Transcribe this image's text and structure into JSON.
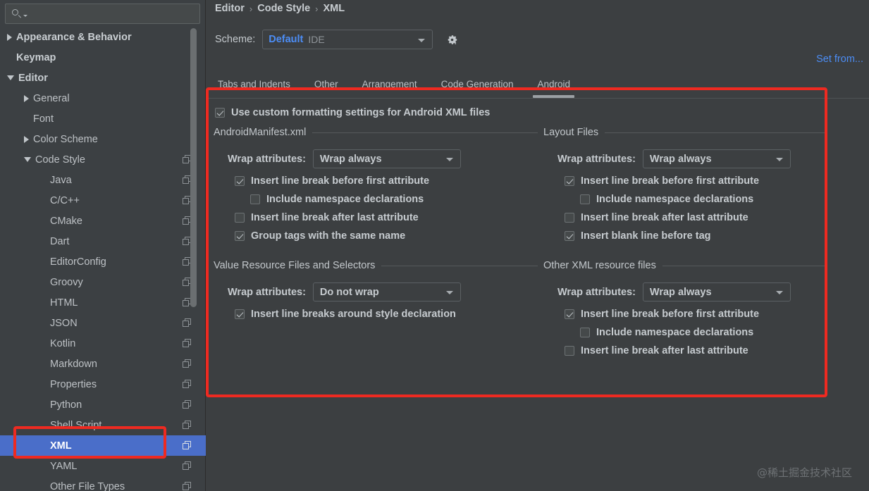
{
  "search": {
    "value": "",
    "placeholder": ""
  },
  "sidebar": {
    "items": [
      {
        "label": "Appearance & Behavior",
        "twisty": "collapsed",
        "indent": 0,
        "bold": true,
        "copy": false,
        "selected": false
      },
      {
        "label": "Keymap",
        "twisty": "none",
        "indent": 0,
        "bold": true,
        "copy": false,
        "selected": false
      },
      {
        "label": "Editor",
        "twisty": "expanded",
        "indent": 0,
        "bold": true,
        "copy": false,
        "selected": false
      },
      {
        "label": "General",
        "twisty": "collapsed",
        "indent": 1,
        "bold": false,
        "copy": false,
        "selected": false
      },
      {
        "label": "Font",
        "twisty": "none",
        "indent": 1,
        "bold": false,
        "copy": false,
        "selected": false
      },
      {
        "label": "Color Scheme",
        "twisty": "collapsed",
        "indent": 1,
        "bold": false,
        "copy": false,
        "selected": false
      },
      {
        "label": "Code Style",
        "twisty": "expanded",
        "indent": 1,
        "bold": false,
        "copy": true,
        "selected": false
      },
      {
        "label": "Java",
        "twisty": "none",
        "indent": 2,
        "bold": false,
        "copy": true,
        "selected": false
      },
      {
        "label": "C/C++",
        "twisty": "none",
        "indent": 2,
        "bold": false,
        "copy": true,
        "selected": false
      },
      {
        "label": "CMake",
        "twisty": "none",
        "indent": 2,
        "bold": false,
        "copy": true,
        "selected": false
      },
      {
        "label": "Dart",
        "twisty": "none",
        "indent": 2,
        "bold": false,
        "copy": true,
        "selected": false
      },
      {
        "label": "EditorConfig",
        "twisty": "none",
        "indent": 2,
        "bold": false,
        "copy": true,
        "selected": false
      },
      {
        "label": "Groovy",
        "twisty": "none",
        "indent": 2,
        "bold": false,
        "copy": true,
        "selected": false
      },
      {
        "label": "HTML",
        "twisty": "none",
        "indent": 2,
        "bold": false,
        "copy": true,
        "selected": false
      },
      {
        "label": "JSON",
        "twisty": "none",
        "indent": 2,
        "bold": false,
        "copy": true,
        "selected": false
      },
      {
        "label": "Kotlin",
        "twisty": "none",
        "indent": 2,
        "bold": false,
        "copy": true,
        "selected": false
      },
      {
        "label": "Markdown",
        "twisty": "none",
        "indent": 2,
        "bold": false,
        "copy": true,
        "selected": false
      },
      {
        "label": "Properties",
        "twisty": "none",
        "indent": 2,
        "bold": false,
        "copy": true,
        "selected": false
      },
      {
        "label": "Python",
        "twisty": "none",
        "indent": 2,
        "bold": false,
        "copy": true,
        "selected": false
      },
      {
        "label": "Shell Script",
        "twisty": "none",
        "indent": 2,
        "bold": false,
        "copy": true,
        "selected": false
      },
      {
        "label": "XML",
        "twisty": "none",
        "indent": 2,
        "bold": false,
        "copy": true,
        "selected": true
      },
      {
        "label": "YAML",
        "twisty": "none",
        "indent": 2,
        "bold": false,
        "copy": true,
        "selected": false
      },
      {
        "label": "Other File Types",
        "twisty": "none",
        "indent": 2,
        "bold": false,
        "copy": true,
        "selected": false
      }
    ]
  },
  "header": {
    "breadcrumb": [
      "Editor",
      "Code Style",
      "XML"
    ],
    "separator": "›",
    "scheme_label": "Scheme:",
    "scheme_name": "Default",
    "scheme_sub": "IDE",
    "set_from_label": "Set from..."
  },
  "tabs": [
    {
      "label": "Tabs and Indents",
      "active": false
    },
    {
      "label": "Other",
      "active": false
    },
    {
      "label": "Arrangement",
      "active": false
    },
    {
      "label": "Code Generation",
      "active": false
    },
    {
      "label": "Android",
      "active": true
    }
  ],
  "content": {
    "use_custom": {
      "label": "Use custom formatting settings for Android XML files",
      "checked": true
    },
    "wrap_attributes_label": "Wrap attributes:",
    "groups": [
      {
        "title": "AndroidManifest.xml",
        "wrap_value": "Wrap always",
        "options": [
          {
            "label": "Insert line break before first attribute",
            "checked": true,
            "indent": false
          },
          {
            "label": "Include namespace declarations",
            "checked": false,
            "indent": true
          },
          {
            "label": "Insert line break after last attribute",
            "checked": false,
            "indent": false
          },
          {
            "label": "Group tags with the same name",
            "checked": true,
            "indent": false
          }
        ]
      },
      {
        "title": "Layout Files",
        "wrap_value": "Wrap always",
        "options": [
          {
            "label": "Insert line break before first attribute",
            "checked": true,
            "indent": false
          },
          {
            "label": "Include namespace declarations",
            "checked": false,
            "indent": true
          },
          {
            "label": "Insert line break after last attribute",
            "checked": false,
            "indent": false
          },
          {
            "label": "Insert blank line before tag",
            "checked": true,
            "indent": false
          }
        ]
      },
      {
        "title": "Value Resource Files and Selectors",
        "wrap_value": "Do not wrap",
        "options": [
          {
            "label": "Insert line breaks around style declaration",
            "checked": true,
            "indent": false
          }
        ]
      },
      {
        "title": "Other XML resource files",
        "wrap_value": "Wrap always",
        "options": [
          {
            "label": "Insert line break before first attribute",
            "checked": true,
            "indent": false
          },
          {
            "label": "Include namespace declarations",
            "checked": false,
            "indent": true
          },
          {
            "label": "Insert line break after last attribute",
            "checked": false,
            "indent": false
          }
        ]
      }
    ]
  },
  "annotations": {
    "color": "#ee2a21"
  },
  "watermark": "@稀土掘金技术社区"
}
